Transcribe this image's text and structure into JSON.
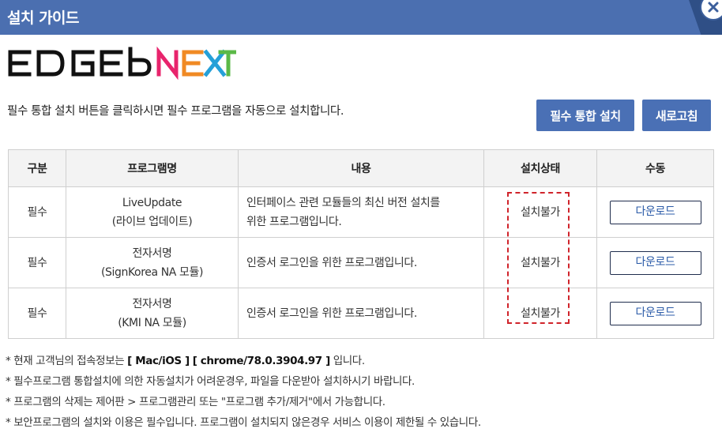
{
  "window": {
    "title": "설치 가이드",
    "close_icon": "close-icon"
  },
  "logo": {
    "text": "EDGE bNEXT",
    "colors": {
      "edge": "#111111",
      "b": "#111111",
      "n": "#e8246c",
      "e": "#f08a24",
      "x": "#25a0d8",
      "t": "#5bb947"
    }
  },
  "description": "필수 통합 설치 버튼을 클릭하시면 필수 프로그램을 자동으로 설치합니다.",
  "buttons": {
    "install": "필수 통합 설치",
    "refresh": "새로고침"
  },
  "table": {
    "headers": [
      "구분",
      "프로그램명",
      "내용",
      "설치상태",
      "수동"
    ],
    "rows": [
      {
        "type": "필수",
        "name1": "LiveUpdate",
        "name2": "(라이브 업데이트)",
        "content1": "인터페이스 관련 모듈들의 최신 버전 설치를",
        "content2": "위한 프로그램입니다.",
        "status": "설치불가",
        "action": "다운로드"
      },
      {
        "type": "필수",
        "name1": "전자서명",
        "name2": "(SignKorea NA 모듈)",
        "content1": "인증서 로그인을 위한 프로그램입니다.",
        "content2": "",
        "status": "설치불가",
        "action": "다운로드"
      },
      {
        "type": "필수",
        "name1": "전자서명",
        "name2": "(KMI NA 모듈)",
        "content1": "인증서 로그인을 위한 프로그램입니다.",
        "content2": "",
        "status": "설치불가",
        "action": "다운로드"
      }
    ]
  },
  "notes": {
    "line1_prefix": "* 현재 고객님의 접속정보는 ",
    "line1_os": "[ Mac/iOS ]",
    "line1_browser": "[ chrome/78.0.3904.97 ]",
    "line1_suffix": " 입니다.",
    "line2": "* 필수프로그램 통합설치에 의한 자동설치가 어려운경우, 파일을 다운받아 설치하시기 바랍니다.",
    "line3": "* 프로그램의 삭제는 제어판 > 프로그램관리 또는 \"프로그램 추가/제거\"에서 가능합니다.",
    "line4": "* 보안프로그램의 설치와 이용은 필수입니다. 프로그램이 설치되지 않은경우 서비스 이용이 제한될 수 있습니다."
  },
  "accent_colors": {
    "titlebar": "#4b6fb0",
    "button": "#4a70b5",
    "highlight": "#d0242b"
  }
}
